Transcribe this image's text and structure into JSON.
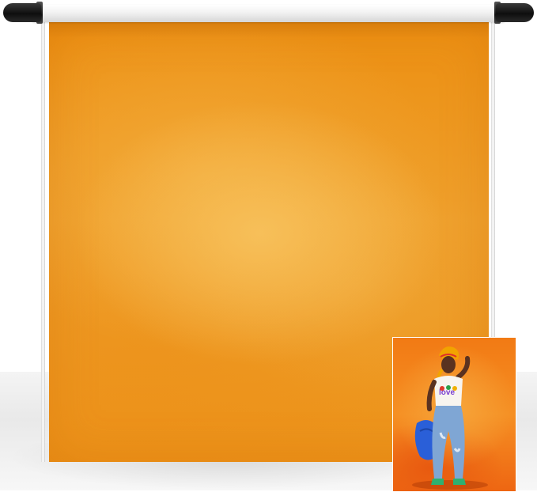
{
  "image": {
    "subject": "orange-backdrop-on-stand",
    "colors": {
      "backdrop_orange": "#ee9520",
      "backdrop_highlight": "#f8c460",
      "stand_white": "#f2f2f2",
      "end_caps": "#111111",
      "inset_orange": "#f27a14"
    },
    "inset": {
      "shirt_logo_text": "love"
    }
  }
}
